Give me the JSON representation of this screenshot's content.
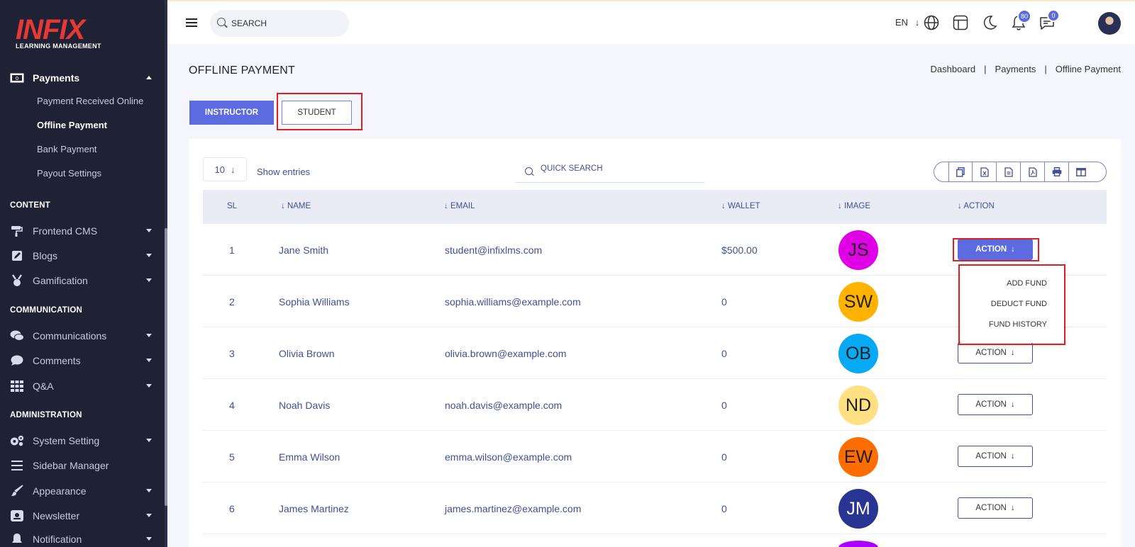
{
  "brand": {
    "name": "INFIX",
    "tagline": "LEARNING MANAGEMENT"
  },
  "sidebar": {
    "payments": {
      "label": "Payments",
      "icon": "money-icon"
    },
    "payment_sub": [
      "Payment Received Online",
      "Offline Payment",
      "Bank Payment",
      "Payout Settings"
    ],
    "sections": {
      "content": "CONTENT",
      "communication": "COMMUNICATION",
      "administration": "ADMINISTRATION"
    },
    "content_items": [
      {
        "label": "Frontend CMS",
        "icon": "paint-roller-icon"
      },
      {
        "label": "Blogs",
        "icon": "edit-icon"
      },
      {
        "label": "Gamification",
        "icon": "medal-icon"
      }
    ],
    "communication_items": [
      {
        "label": "Communications",
        "icon": "chat-icon"
      },
      {
        "label": "Comments",
        "icon": "comment-icon"
      },
      {
        "label": "Q&A",
        "icon": "grid-icon"
      }
    ],
    "admin_items": [
      {
        "label": "System Setting",
        "icon": "gears-icon"
      },
      {
        "label": "Sidebar Manager",
        "icon": "bars-icon"
      },
      {
        "label": "Appearance",
        "icon": "brush-icon"
      },
      {
        "label": "Newsletter",
        "icon": "newsletter-icon"
      },
      {
        "label": "Notification",
        "icon": "bell-icon"
      }
    ]
  },
  "topbar": {
    "search_placeholder": "SEARCH",
    "language": "EN",
    "notifications_count": "80",
    "messages_count": "0"
  },
  "page": {
    "title": "OFFLINE PAYMENT",
    "breadcrumb": [
      "Dashboard",
      "Payments",
      "Offline Payment"
    ],
    "tabs": {
      "instructor": "INSTRUCTOR",
      "student": "STUDENT"
    }
  },
  "table": {
    "entries_value": "10",
    "entries_label": "Show entries",
    "quick_search_placeholder": "QUICK SEARCH",
    "headers": {
      "sl": "SL",
      "name": "NAME",
      "email": "EMAIL",
      "wallet": "WALLET",
      "image": "IMAGE",
      "action": "ACTION"
    },
    "action_label": "ACTION",
    "rows": [
      {
        "sl": "1",
        "name": "Jane Smith",
        "email": "student@infixlms.com",
        "wallet": "$500.00",
        "initials": "JS",
        "color": "#e000e6"
      },
      {
        "sl": "2",
        "name": "Sophia Williams",
        "email": "sophia.williams@example.com",
        "wallet": "0",
        "initials": "SW",
        "color": "#ffb300"
      },
      {
        "sl": "3",
        "name": "Olivia Brown",
        "email": "olivia.brown@example.com",
        "wallet": "0",
        "initials": "OB",
        "color": "#05a9f4"
      },
      {
        "sl": "4",
        "name": "Noah Davis",
        "email": "noah.davis@example.com",
        "wallet": "0",
        "initials": "ND",
        "color": "#ffe082"
      },
      {
        "sl": "5",
        "name": "Emma Wilson",
        "email": "emma.wilson@example.com",
        "wallet": "0",
        "initials": "EW",
        "color": "#ff6d00"
      },
      {
        "sl": "6",
        "name": "James Martinez",
        "email": "james.martinez@example.com",
        "wallet": "0",
        "initials": "JM",
        "color": "#283593"
      }
    ],
    "dropdown": [
      "ADD FUND",
      "DEDUCT FUND",
      "FUND HISTORY"
    ]
  },
  "colors": {
    "accent": "#5c6ce0",
    "sidebar": "#1f2235",
    "highlight": "#e02020"
  }
}
